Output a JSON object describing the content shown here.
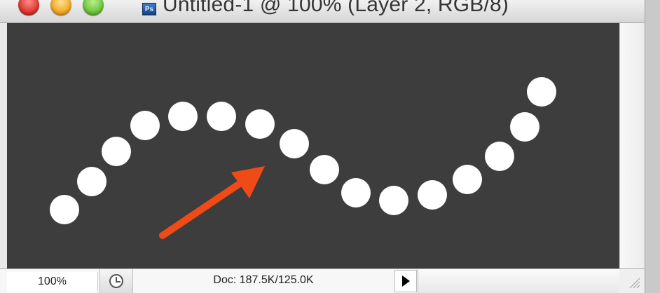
{
  "window": {
    "title": "Untitled-1 @ 100% (Layer 2, RGB/8)",
    "app_icon_label": "Ps",
    "controls": [
      "close-button",
      "minimize-button",
      "zoom-button"
    ]
  },
  "canvas": {
    "background": "#3d3d3d",
    "dot_color": "#ffffff",
    "arrow_color": "#f04b16"
  },
  "statusbar": {
    "zoom_value": "100%",
    "doc_info": "Doc: 187.5K/125.0K"
  },
  "icons": {
    "history": "history-icon",
    "menu_arrow": "play-triangle-icon",
    "resize": "resize-grip-icon"
  }
}
